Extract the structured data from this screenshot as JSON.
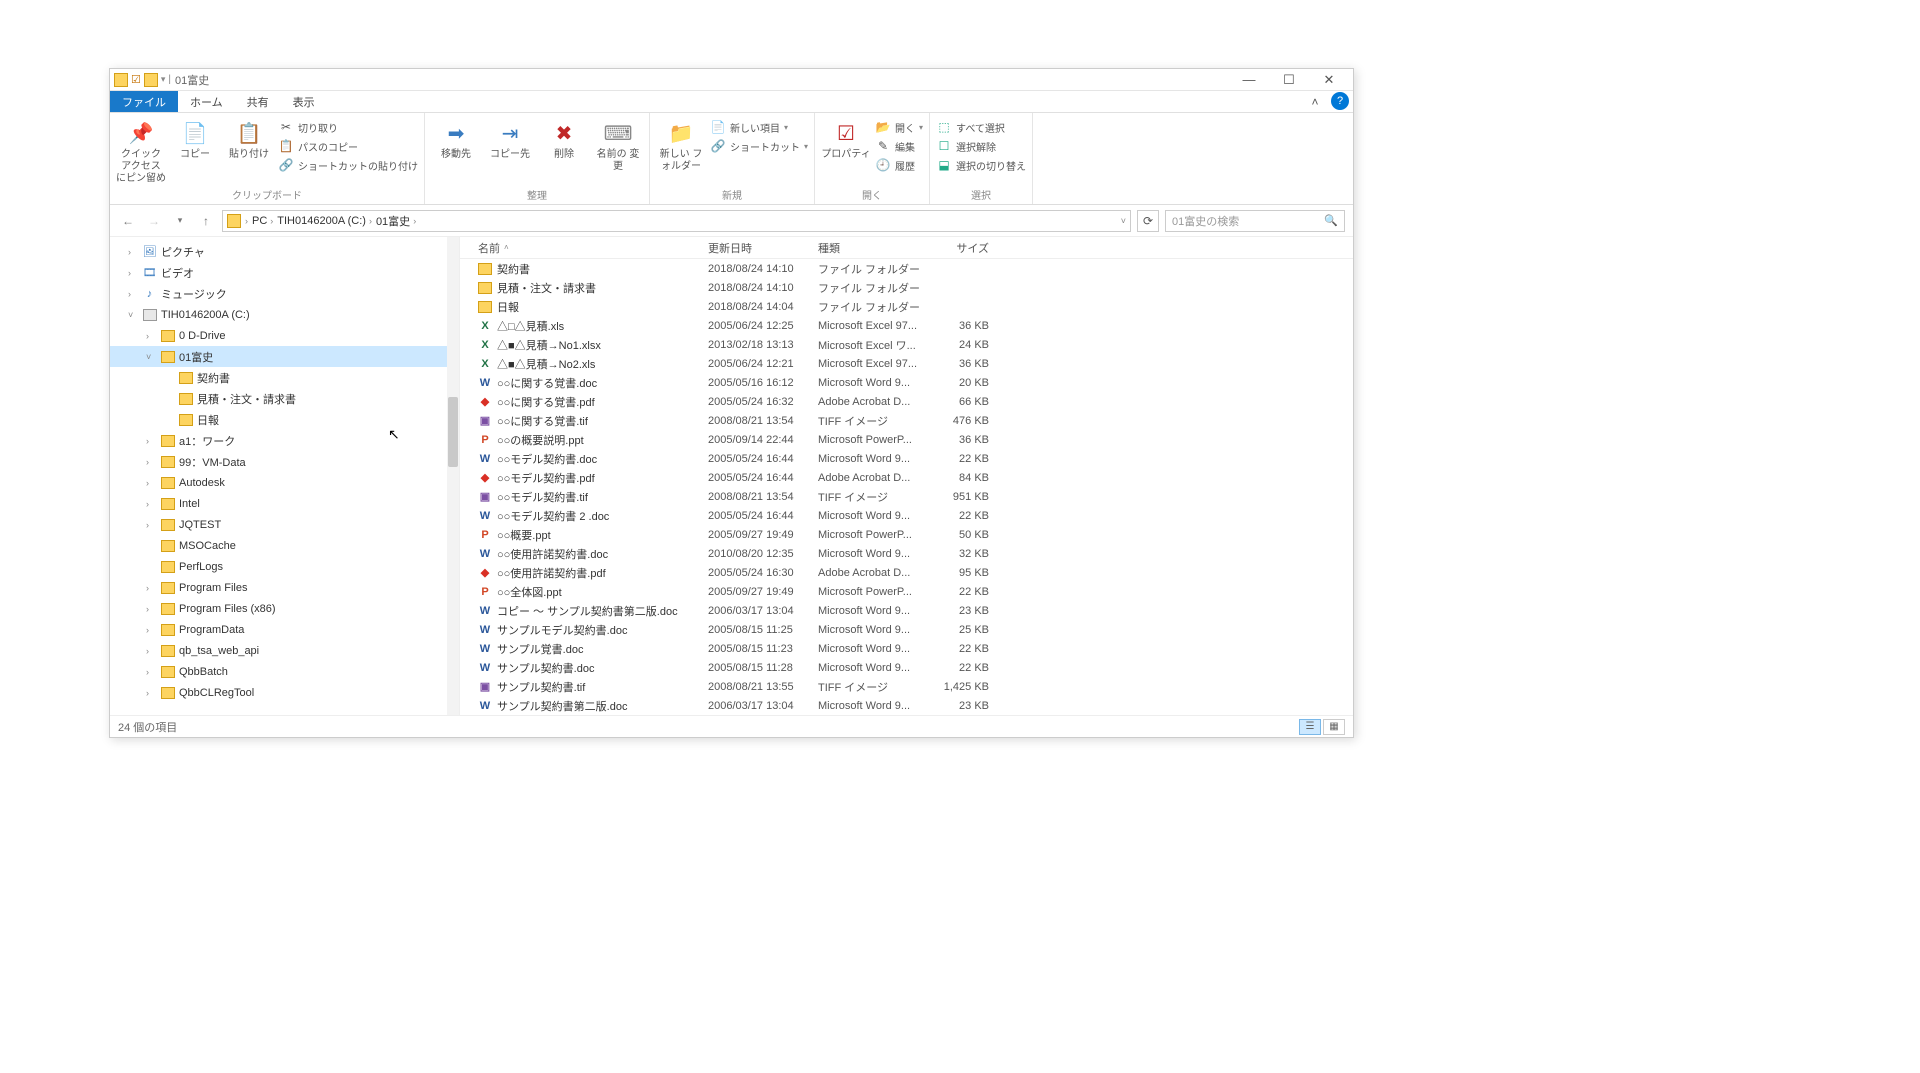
{
  "window_title": "01富史",
  "tabs": {
    "file": "ファイル",
    "home": "ホーム",
    "share": "共有",
    "view": "表示"
  },
  "ribbon": {
    "clipboard": {
      "pin": "クイック アクセス\nにピン留め",
      "copy": "コピー",
      "paste": "貼り付け",
      "cut": "切り取り",
      "copypath": "パスのコピー",
      "pasteshortcut": "ショートカットの貼り付け",
      "group": "クリップボード"
    },
    "organize": {
      "moveto": "移動先",
      "copyto": "コピー先",
      "delete": "削除",
      "rename": "名前の\n変更",
      "group": "整理"
    },
    "new": {
      "newfolder": "新しい\nフォルダー",
      "newitem": "新しい項目",
      "shortcut": "ショートカット",
      "group": "新規"
    },
    "open": {
      "properties": "プロパティ",
      "open": "開く",
      "edit": "編集",
      "history": "履歴",
      "group": "開く"
    },
    "select": {
      "selectall": "すべて選択",
      "selectnone": "選択解除",
      "invert": "選択の切り替え",
      "group": "選択"
    }
  },
  "breadcrumbs": [
    "PC",
    "TIH0146200A (C:)",
    "01富史"
  ],
  "search_placeholder": "01富史の検索",
  "columns": {
    "name": "名前",
    "date": "更新日時",
    "type": "種類",
    "size": "サイズ"
  },
  "tree": [
    {
      "depth": 0,
      "chev": ">",
      "icon": "pic",
      "label": "ピクチャ"
    },
    {
      "depth": 0,
      "chev": ">",
      "icon": "vid",
      "label": "ビデオ"
    },
    {
      "depth": 0,
      "chev": ">",
      "icon": "mus",
      "label": "ミュージック"
    },
    {
      "depth": 0,
      "chev": "v",
      "icon": "drv",
      "label": "TIH0146200A (C:)"
    },
    {
      "depth": 1,
      "chev": ">",
      "icon": "fld",
      "label": "0 D-Drive"
    },
    {
      "depth": 1,
      "chev": "v",
      "icon": "fld",
      "label": "01富史",
      "selected": true
    },
    {
      "depth": 2,
      "chev": "",
      "icon": "fld",
      "label": "契約書"
    },
    {
      "depth": 2,
      "chev": "",
      "icon": "fld",
      "label": "見積・注文・請求書"
    },
    {
      "depth": 2,
      "chev": "",
      "icon": "fld",
      "label": "日報"
    },
    {
      "depth": 1,
      "chev": ">",
      "icon": "fld",
      "label": "a1：ワーク"
    },
    {
      "depth": 1,
      "chev": ">",
      "icon": "fld",
      "label": "99：VM-Data"
    },
    {
      "depth": 1,
      "chev": ">",
      "icon": "fld",
      "label": "Autodesk"
    },
    {
      "depth": 1,
      "chev": ">",
      "icon": "fld",
      "label": "Intel"
    },
    {
      "depth": 1,
      "chev": ">",
      "icon": "fld",
      "label": "JQTEST"
    },
    {
      "depth": 1,
      "chev": "",
      "icon": "fld",
      "label": "MSOCache"
    },
    {
      "depth": 1,
      "chev": "",
      "icon": "fld",
      "label": "PerfLogs"
    },
    {
      "depth": 1,
      "chev": ">",
      "icon": "fld",
      "label": "Program Files"
    },
    {
      "depth": 1,
      "chev": ">",
      "icon": "fld",
      "label": "Program Files (x86)"
    },
    {
      "depth": 1,
      "chev": ">",
      "icon": "fld",
      "label": "ProgramData"
    },
    {
      "depth": 1,
      "chev": ">",
      "icon": "fld",
      "label": "qb_tsa_web_api"
    },
    {
      "depth": 1,
      "chev": ">",
      "icon": "fld",
      "label": "QbbBatch"
    },
    {
      "depth": 1,
      "chev": ">",
      "icon": "fld",
      "label": "QbbCLRegTool"
    }
  ],
  "files": [
    {
      "icon": "folder",
      "name": "契約書",
      "date": "2018/08/24 14:10",
      "type": "ファイル フォルダー",
      "size": ""
    },
    {
      "icon": "folder",
      "name": "見積・注文・請求書",
      "date": "2018/08/24 14:10",
      "type": "ファイル フォルダー",
      "size": ""
    },
    {
      "icon": "folder",
      "name": "日報",
      "date": "2018/08/24 14:04",
      "type": "ファイル フォルダー",
      "size": ""
    },
    {
      "icon": "xls",
      "name": "△□△見積.xls",
      "date": "2005/06/24 12:25",
      "type": "Microsoft Excel 97...",
      "size": "36 KB"
    },
    {
      "icon": "xls",
      "name": "△■△見積→No1.xlsx",
      "date": "2013/02/18 13:13",
      "type": "Microsoft Excel ワ...",
      "size": "24 KB"
    },
    {
      "icon": "xls",
      "name": "△■△見積→No2.xls",
      "date": "2005/06/24 12:21",
      "type": "Microsoft Excel 97...",
      "size": "36 KB"
    },
    {
      "icon": "doc",
      "name": "○○に関する覚書.doc",
      "date": "2005/05/16 16:12",
      "type": "Microsoft Word 9...",
      "size": "20 KB"
    },
    {
      "icon": "pdf",
      "name": "○○に関する覚書.pdf",
      "date": "2005/05/24 16:32",
      "type": "Adobe Acrobat D...",
      "size": "66 KB"
    },
    {
      "icon": "tif",
      "name": "○○に関する覚書.tif",
      "date": "2008/08/21 13:54",
      "type": "TIFF イメージ",
      "size": "476 KB"
    },
    {
      "icon": "ppt",
      "name": "○○の概要説明.ppt",
      "date": "2005/09/14 22:44",
      "type": "Microsoft PowerP...",
      "size": "36 KB"
    },
    {
      "icon": "doc",
      "name": "○○モデル契約書.doc",
      "date": "2005/05/24 16:44",
      "type": "Microsoft Word 9...",
      "size": "22 KB"
    },
    {
      "icon": "pdf",
      "name": "○○モデル契約書.pdf",
      "date": "2005/05/24 16:44",
      "type": "Adobe Acrobat D...",
      "size": "84 KB"
    },
    {
      "icon": "tif",
      "name": "○○モデル契約書.tif",
      "date": "2008/08/21 13:54",
      "type": "TIFF イメージ",
      "size": "951 KB"
    },
    {
      "icon": "doc",
      "name": "○○モデル契約書 2 .doc",
      "date": "2005/05/24 16:44",
      "type": "Microsoft Word 9...",
      "size": "22 KB"
    },
    {
      "icon": "ppt",
      "name": "○○概要.ppt",
      "date": "2005/09/27 19:49",
      "type": "Microsoft PowerP...",
      "size": "50 KB"
    },
    {
      "icon": "doc",
      "name": "○○使用許諾契約書.doc",
      "date": "2010/08/20 12:35",
      "type": "Microsoft Word 9...",
      "size": "32 KB"
    },
    {
      "icon": "pdf",
      "name": "○○使用許諾契約書.pdf",
      "date": "2005/05/24 16:30",
      "type": "Adobe Acrobat D...",
      "size": "95 KB"
    },
    {
      "icon": "ppt",
      "name": "○○全体図.ppt",
      "date": "2005/09/27 19:49",
      "type": "Microsoft PowerP...",
      "size": "22 KB"
    },
    {
      "icon": "doc",
      "name": "コピー ～ サンプル契約書第二版.doc",
      "date": "2006/03/17 13:04",
      "type": "Microsoft Word 9...",
      "size": "23 KB"
    },
    {
      "icon": "doc",
      "name": "サンプルモデル契約書.doc",
      "date": "2005/08/15 11:25",
      "type": "Microsoft Word 9...",
      "size": "25 KB"
    },
    {
      "icon": "doc",
      "name": "サンプル覚書.doc",
      "date": "2005/08/15 11:23",
      "type": "Microsoft Word 9...",
      "size": "22 KB"
    },
    {
      "icon": "doc",
      "name": "サンプル契約書.doc",
      "date": "2005/08/15 11:28",
      "type": "Microsoft Word 9...",
      "size": "22 KB"
    },
    {
      "icon": "tif",
      "name": "サンプル契約書.tif",
      "date": "2008/08/21 13:55",
      "type": "TIFF イメージ",
      "size": "1,425 KB"
    },
    {
      "icon": "doc",
      "name": "サンプル契約書第二版.doc",
      "date": "2006/03/17 13:04",
      "type": "Microsoft Word 9...",
      "size": "23 KB"
    }
  ],
  "status_text": "24 個の項目"
}
